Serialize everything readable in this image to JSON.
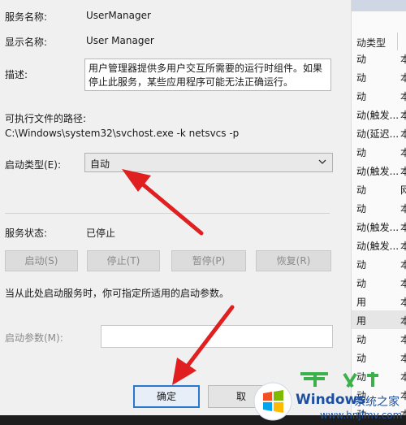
{
  "dialog": {
    "service_name_label": "服务名称:",
    "service_name_value": "UserManager",
    "display_name_label": "显示名称:",
    "display_name_value": "User Manager",
    "description_label": "描述:",
    "description_value": "用户管理器提供多用户交互所需要的运行时组件。如果停止此服务，某些应用程序可能无法正确运行。",
    "exe_path_label": "可执行文件的路径:",
    "exe_path_value": "C:\\Windows\\system32\\svchost.exe -k netsvcs -p",
    "startup_type_label": "启动类型(E):",
    "startup_type_value": "自动",
    "service_status_label": "服务状态:",
    "service_status_value": "已停止",
    "buttons": {
      "start": "启动(S)",
      "stop": "停止(T)",
      "pause": "暂停(P)",
      "resume": "恢复(R)"
    },
    "hint_text": "当从此处启动服务时，你可指定所适用的启动参数。",
    "start_params_label": "启动参数(M):",
    "start_params_value": "",
    "ok_label": "确定",
    "cancel_label": "取"
  },
  "services_list": {
    "header": "动类型",
    "rows": [
      {
        "type": "动",
        "col2": "本"
      },
      {
        "type": "动",
        "col2": "本"
      },
      {
        "type": "动",
        "col2": "本"
      },
      {
        "type": "动(触发...",
        "col2": "本"
      },
      {
        "type": "动(延迟...",
        "col2": "本"
      },
      {
        "type": "动",
        "col2": "本"
      },
      {
        "type": "动(触发...",
        "col2": "本"
      },
      {
        "type": "动",
        "col2": "网"
      },
      {
        "type": "动",
        "col2": "本"
      },
      {
        "type": "动(触发...",
        "col2": "本"
      },
      {
        "type": "动(触发...",
        "col2": "本"
      },
      {
        "type": "动",
        "col2": "本"
      },
      {
        "type": "动",
        "col2": "本"
      },
      {
        "type": "用",
        "col2": "本"
      },
      {
        "type": "用",
        "col2": "本"
      },
      {
        "type": "动",
        "col2": "本"
      },
      {
        "type": "动",
        "col2": "本"
      },
      {
        "type": "动",
        "col2": "本"
      },
      {
        "type": "动",
        "col2": "本"
      },
      {
        "type": "动",
        "col2": "本"
      }
    ]
  },
  "watermark": {
    "brand": "Windows",
    "cn": "系统之家",
    "url": "www.hnjlmv.com"
  },
  "colors": {
    "arrow": "#e02020",
    "accent": "#2878d0",
    "dialog_bg": "#f0f0f0"
  }
}
